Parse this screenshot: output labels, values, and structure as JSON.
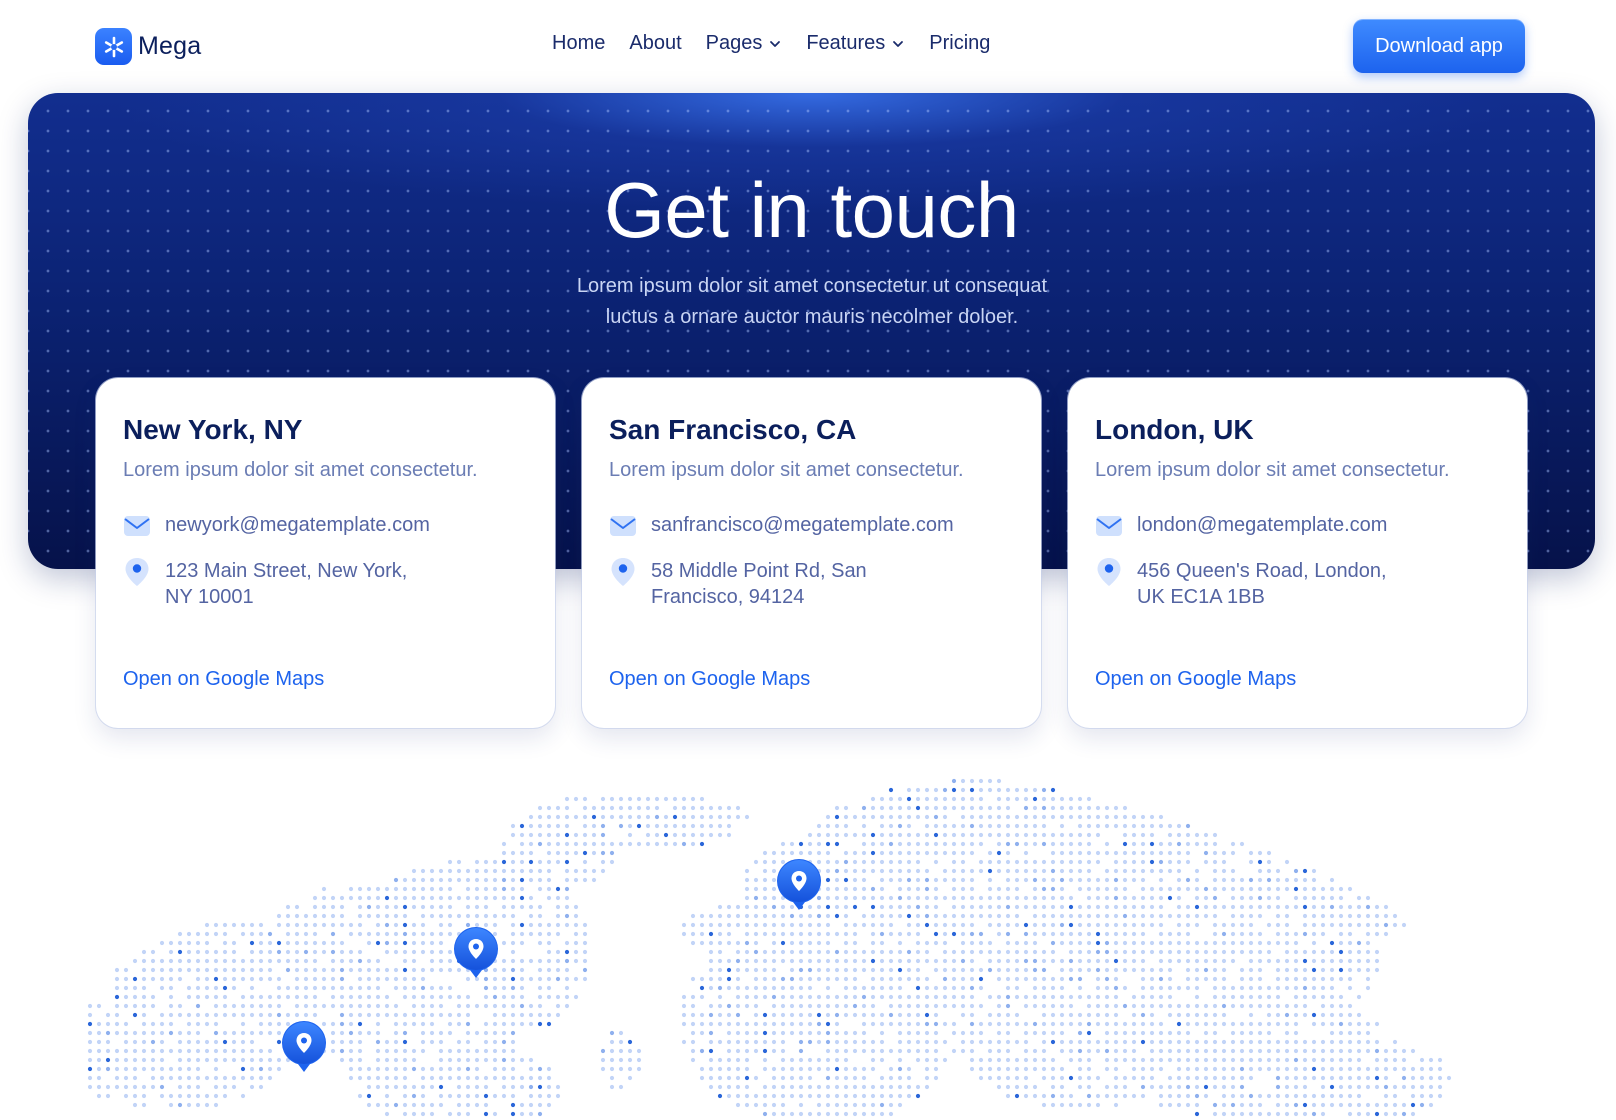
{
  "nav": {
    "brand": "Mega",
    "menu": [
      {
        "label": "Home"
      },
      {
        "label": "About"
      },
      {
        "label": "Pages"
      },
      {
        "label": "Features"
      },
      {
        "label": "Pricing"
      }
    ],
    "cta": "Download app"
  },
  "hero": {
    "title": "Get in touch",
    "subtitle": "Lorem ipsum dolor sit amet consectetur ut consequat luctus a ornare auctor mauris necolmer doloer."
  },
  "offices": [
    {
      "city": "New York, NY",
      "description": "Lorem ipsum dolor sit amet consectetur.",
      "email": "newyork@megatemplate.com",
      "address": "123 Main Street, New York, NY 10001",
      "link": "Open on Google Maps"
    },
    {
      "city": "San Francisco, CA",
      "description": "Lorem ipsum dolor sit amet consectetur.",
      "email": "sanfrancisco@megatemplate.com",
      "address": "58 Middle Point Rd, San Francisco, 94124",
      "link": "Open on Google Maps"
    },
    {
      "city": "London, UK",
      "description": "Lorem ipsum dolor sit amet consectetur.",
      "email": "london@megatemplate.com",
      "address": "456 Queen's Road, London, UK EC1A 1BB",
      "link": "Open on Google Maps"
    }
  ],
  "icons": {
    "logo": "asterisk-icon",
    "email": "mail-icon",
    "address": "location-dot-icon",
    "map_pin": "map-pin-icon",
    "dropdown": "chevron-down-icon"
  },
  "colors": {
    "brand": "#1d63ee",
    "hero_dark": "#06124a",
    "heading": "#0b1f5c",
    "body_text": "#6b7db4",
    "map_dot": "#c2d4f7"
  }
}
